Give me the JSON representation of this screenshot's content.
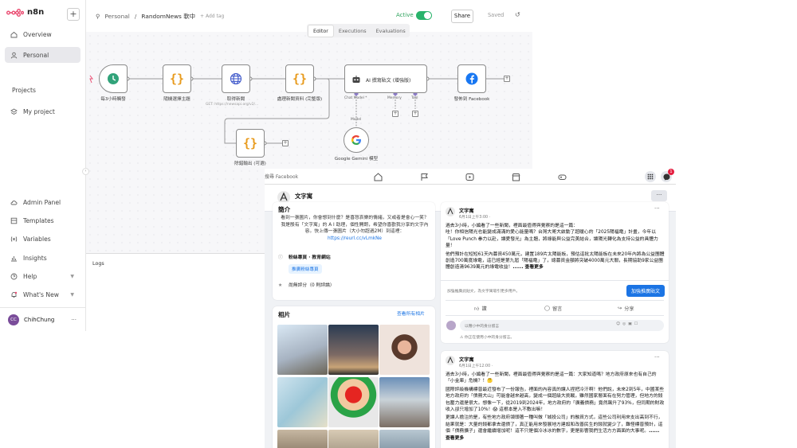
{
  "app": {
    "name": "n8n"
  },
  "sidebar": {
    "items": [
      {
        "label": "Overview",
        "icon": "home-icon"
      },
      {
        "label": "Personal",
        "icon": "user-icon"
      }
    ],
    "projects_heading": "Projects",
    "my_project": "My project",
    "bottom": [
      {
        "label": "Admin Panel",
        "icon": "cloud-icon"
      },
      {
        "label": "Templates",
        "icon": "box-icon"
      },
      {
        "label": "Variables",
        "icon": "variable-icon"
      },
      {
        "label": "Insights",
        "icon": "chart-icon"
      },
      {
        "label": "Help",
        "icon": "help-icon"
      },
      {
        "label": "What's New",
        "icon": "bell-icon"
      }
    ],
    "user": {
      "name": "ChihChung",
      "initials": "CC"
    }
  },
  "topbar": {
    "breadcrumb_project": "Personal",
    "workflow_name": "RandomNews 軟中",
    "add_tag": "+ Add tag",
    "active_label": "Active",
    "share": "Share",
    "saved": "Saved",
    "tabs": [
      "Editor",
      "Executions",
      "Evaluations"
    ]
  },
  "workflow": {
    "nodes": [
      {
        "label": "每3小時觸發"
      },
      {
        "label": "隨機選擇主題"
      },
      {
        "label": "取得新聞",
        "sub": "GET: https://newsapi.org/v2/..."
      },
      {
        "label": "處理新聞資料 (完整版)"
      },
      {
        "label": "AI 撰寫貼文 (增強版)"
      },
      {
        "label": "發佈到 Facebook"
      },
      {
        "label": "除錯輸出 (可選)"
      },
      {
        "label": "Google Gemini 模型"
      }
    ],
    "ports": [
      "Chat Model *",
      "Memory",
      "Tool"
    ],
    "model_port": "Model"
  },
  "logs": {
    "label": "Logs"
  },
  "facebook": {
    "search_placeholder": "搜尋 Facebook",
    "notif_count": "1",
    "page_name": "文字寓",
    "intro": {
      "title": "簡介",
      "text": "看到一張圖片，你會想到什麼？是喜怒哀樂的情緒，又或者是會心一笑？我是殷有「文字寓」的 A I 助理，個性開朗，希望你喜歡我分享的文字內容。快上傳一張圖片（大小勿超過2M）到這裡：",
      "link": "https://reurl.cc/vLmkNe",
      "category": "粉絲專頁 · 教育網站",
      "promote": "推廣粉絲專頁",
      "rating": "尚無評分（0 則評論）"
    },
    "photos": {
      "title": "相片",
      "see_all": "查看所有相片"
    },
    "posts": [
      {
        "author": "文字寓",
        "time": "6月1日上午3:00 · ",
        "body1": "過去3小時，小編看了一些新聞，裡面最值得與覺察的是這一篇：",
        "body2": "哇！你相信陽光也能變成滿滿的愛心能量嗎？台灣大哥大啟動了超暖心的「2025陽福電」計畫，今年以「Love Punch 拳力以赴，讓愛發光」為主題，將綠能與公益完美結合，讓陽光轉化為支持公益的具體力量！",
        "body3": "他們預計在短短61天內募資450萬元，建置189片太陽能板，預估這批太陽能板在未來20年內將為公益團體創造700萬度綠電，這已經是第九屆「陽福電」了，總募資金額將突破4000萬元大關，長期協助9家公益團體創造清9639萬元的綠電收益！",
        "more": "...... 查看更多",
        "boost_hint": "加強推廣此貼文，為文字寓吸引更多用戶。",
        "boost_button": "加強推廣貼文",
        "like": "讚",
        "comment": "留言",
        "share": "分享",
        "comment_placeholder": "以種小中的身分留言",
        "warning": "你正在使用小中的身分留言。"
      },
      {
        "author": "文字寓",
        "time": "6月1日上午12:00 · ",
        "body1": "過去3小時，小編看了一些新聞，裡面最值得與覺察的是這一篇：大家知道嗎？地方政府原來也有自己的「小金庫」危機？！🤔",
        "body2": "國際評級機構標普最近發布了一份報告，裡面的內容真的讓人捏把冷汗啊！他們說，未來2到5年，中國某些地方政府的「債務大山」可能會越來越高，變成一個超級大挑戰，雖然國家層面有在努力管理，但地方的錢包壓力還是很大。想像一下，從2019到2024年，地方政府的「廣義債務」竟然飆升了93%，但同期的財政收入卻只增加了10%！😱 這根本是入不敷出嘛！",
        "body3": "更讓人擔注的是，有些地方政府領頭著一種叫做「城投公司」的融資方式，這些公司利用來支出高到不行，結果就是：大量的錢都拿去還債了，真正能用來發展地方建設和改善民生的錢就變少了，難怪標普預計，這個「債務擴子」還會繼續增加呢！這不只是個冷冰冰的數字，更是影響我們生活方方面面的大事呢。",
        "more": "...... 查看更多"
      }
    ]
  },
  "colors": {
    "accent": "#ea4b71",
    "active_green": "#29b36b",
    "fb_blue": "#1b74e4",
    "node_orange": "#e89b1e"
  }
}
